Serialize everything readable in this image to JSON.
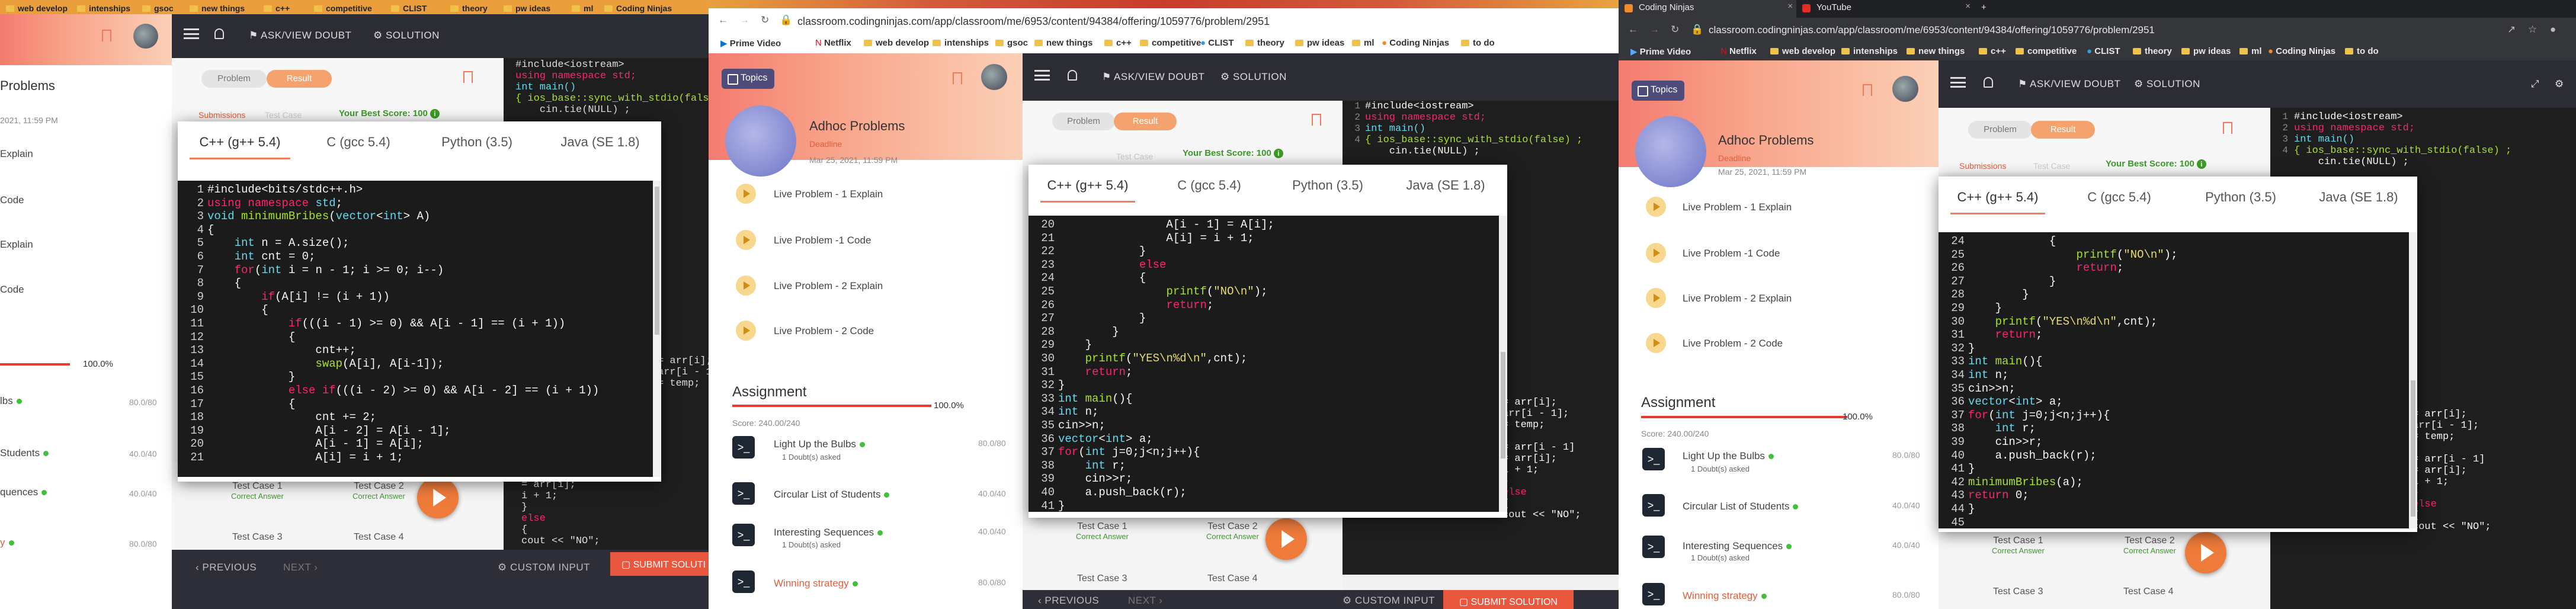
{
  "course": {
    "tab_problem": "Problem",
    "tab_result": "Result",
    "tab_submissions": "Submissions",
    "tab_testcase": "Test Case",
    "best_score": "Your Best Score: 100",
    "section_title": "Adhoc Problems",
    "deadline_label": "Deadline",
    "deadline_date": "Mar 25, 2021, 11:59 PM",
    "deadline_fragment": "2021, 11:59 PM",
    "problems_fragment": "Problems",
    "topics_label": "Topics"
  },
  "nav": {
    "ask_doubt": "ASK/VIEW DOUBT",
    "solution": "SOLUTION",
    "previous": "PREVIOUS",
    "next": "NEXT",
    "custom_input": "CUSTOM INPUT",
    "submit_solution": "SUBMIT SOLUTION",
    "submit_fragment": "SUBMIT SOLUTI"
  },
  "lectures": [
    {
      "title": "Live Problem - 1 Explain"
    },
    {
      "title": "Live Problem -1 Code"
    },
    {
      "title": "Live Problem - 2 Explain"
    },
    {
      "title": "Live Problem - 2 Code"
    }
  ],
  "lecture_fragments": [
    "Explain",
    "Code",
    "Explain",
    "Code"
  ],
  "assignment": {
    "title": "Assignment",
    "percent": "100.0%",
    "score": "Score: 240.00/240",
    "problems": [
      {
        "name": "Light Up the Bulbs",
        "doubt": "1 Doubt(s) asked",
        "score": "80.0/80"
      },
      {
        "name": "Circular List of Students",
        "doubt": "",
        "score": "40.0/40"
      },
      {
        "name": "Interesting Sequences",
        "doubt": "1 Doubt(s) asked",
        "score": "40.0/40"
      },
      {
        "name": "Winning strategy",
        "doubt": "",
        "score": "80.0/80"
      }
    ],
    "fragments": [
      "lbs",
      "Students",
      "quences",
      "y"
    ],
    "fragment_scores": [
      "80.0/80",
      "40.0/40",
      "40.0/40",
      "80.0/80"
    ]
  },
  "testcases": [
    {
      "name": "Test Case 1",
      "status": "Correct Answer"
    },
    {
      "name": "Test Case 2",
      "status": "Correct Answer"
    },
    {
      "name": "Test Case 3",
      "status": ""
    },
    {
      "name": "Test Case 4",
      "status": ""
    }
  ],
  "languages": [
    "C++ (g++ 5.4)",
    "C (gcc 5.4)",
    "Python (3.5)",
    "Java (SE 1.8)"
  ],
  "browser": {
    "url": "classroom.codingninjas.com/app/classroom/me/6953/content/94384/offering/1059776/problem/2951",
    "tab1": "Coding Ninjas",
    "tab2": "YouTube",
    "bookmarks": [
      "Prime Video",
      "Netflix",
      "web develop",
      "intenships",
      "gsoc",
      "new things",
      "c++",
      "competitive",
      "CLIST",
      "theory",
      "pw ideas",
      "ml",
      "Coding Ninjas",
      "to do"
    ]
  },
  "code_panel1": {
    "start": 1,
    "lines": [
      "#include<bits/stdc++.h>",
      "using namespace std;",
      "void minimumBribes(vector<int> A)",
      "{",
      "    int n = A.size();",
      "    int cnt = 0;",
      "    for(int i = n - 1; i >= 0; i--)",
      "    {",
      "        if(A[i] != (i + 1))",
      "        {",
      "            if(((i - 1) >= 0) && A[i - 1] == (i + 1))",
      "            {",
      "                cnt++;",
      "                swap(A[i], A[i-1]);",
      "            }",
      "            else if(((i - 2) >= 0) && A[i - 2] == (i + 1))",
      "            {",
      "                cnt += 2;",
      "                A[i - 2] = A[i - 1];",
      "                A[i - 1] = A[i];",
      "                A[i] = i + 1;"
    ]
  },
  "code_panel2": {
    "start": 20,
    "lines": [
      "                A[i - 1] = A[i];",
      "                A[i] = i + 1;",
      "            }",
      "            else",
      "            {",
      "                printf(\"NO\\n\");",
      "                return;",
      "            }",
      "        }",
      "    }",
      "    printf(\"YES\\n%d\\n\",cnt);",
      "    return;",
      "}",
      "int main(){",
      "int n;",
      "cin>>n;",
      "vector<int> a;",
      "for(int j=0;j<n;j++){",
      "    int r;",
      "    cin>>r;",
      "    a.push_back(r);",
      "}"
    ]
  },
  "code_panel3": {
    "start": 24,
    "lines": [
      "            {",
      "                printf(\"NO\\n\");",
      "                return;",
      "            }",
      "        }",
      "    }",
      "    printf(\"YES\\n%d\\n\",cnt);",
      "    return;",
      "}",
      "int main(){",
      "int n;",
      "cin>>n;",
      "vector<int> a;",
      "for(int j=0;j<n;j++){",
      "    int r;",
      "    cin>>r;",
      "    a.push_back(r);",
      "}",
      "minimumBribes(a);",
      "return 0;",
      "}",
      ""
    ]
  },
  "bg_code": {
    "header": [
      "#include<iostream>",
      "using namespace std;",
      "int main()",
      "{ ios_base::sync_with_stdio(false) ;",
      "    cin.tie(NULL) ;"
    ],
    "middle": [
      "= arr[i];",
      "arr[i - 1];",
      "= temp;"
    ],
    "bottom": [
      "= arr[i - 1]",
      "= arr[i];",
      "i + 1;",
      "}",
      "else",
      "{",
      "cout << \"NO\";"
    ]
  },
  "colors": {
    "accent": "#f2805e",
    "green": "#3d9a2a",
    "dark": "#1e1e1e",
    "nav": "#2c2c34"
  }
}
